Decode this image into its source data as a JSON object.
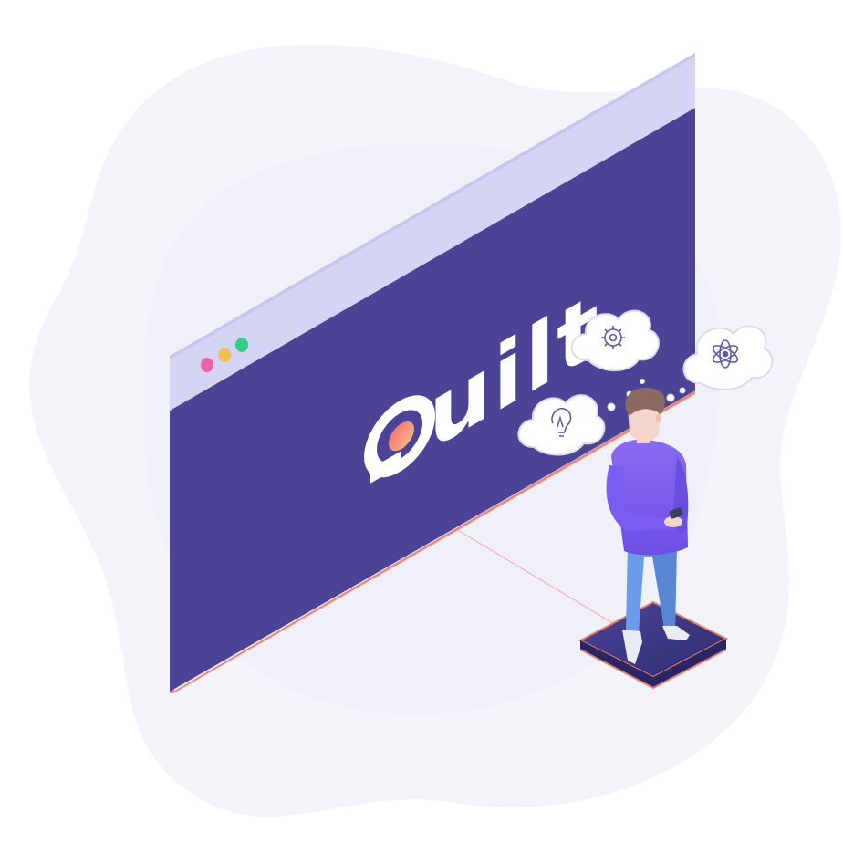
{
  "brand": {
    "name": "Quilt",
    "logo_text_rest": "uilt",
    "logo_accent": [
      "#f06b6b",
      "#f9c08d"
    ]
  },
  "window": {
    "title_bar_color": "#d4d4f5",
    "body_color": "#4b4496",
    "border_color": "#e98a7c",
    "dots": [
      {
        "name": "close",
        "color": "#f062a8"
      },
      {
        "name": "minimize",
        "color": "#f3c04d"
      },
      {
        "name": "maximize",
        "color": "#2fcf86"
      }
    ]
  },
  "thought_bubbles": [
    {
      "icon": "gear-icon"
    },
    {
      "icon": "atom-icon"
    },
    {
      "icon": "lightbulb-icon"
    }
  ],
  "person": {
    "shirt_color": "#7b5cf0",
    "pants_color": "#6c9bea",
    "hair_color": "#8b6b60"
  },
  "colors": {
    "background_blob": "#f4f4f9",
    "platform": "#3e3a87",
    "platform_edge": "#e7826f"
  }
}
